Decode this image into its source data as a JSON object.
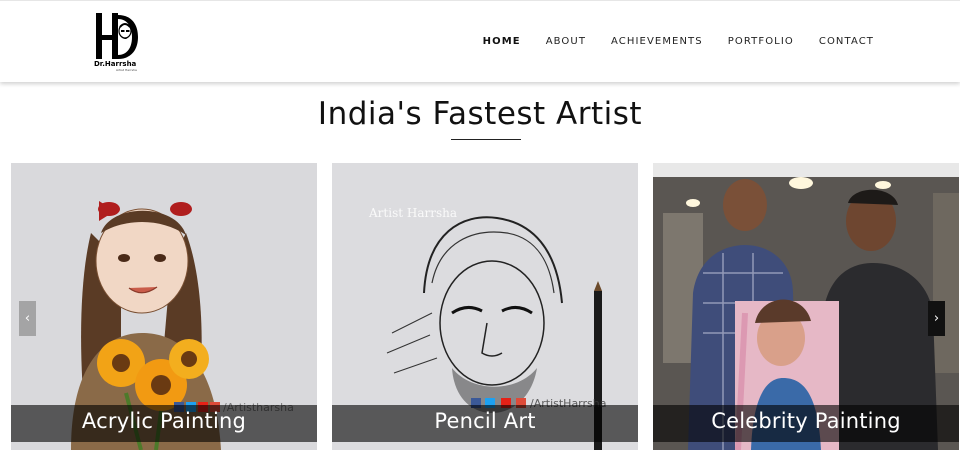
{
  "logo": {
    "caption": "Dr.Harrsha",
    "sub": "Artist Harrsha"
  },
  "nav": {
    "items": [
      {
        "label": "HOME",
        "active": true
      },
      {
        "label": "ABOUT",
        "active": false
      },
      {
        "label": "ACHIEVEMENTS",
        "active": false
      },
      {
        "label": "PORTFOLIO",
        "active": false
      },
      {
        "label": "CONTACT",
        "active": false
      }
    ]
  },
  "hero": {
    "title": "India's Fastest Artist"
  },
  "carousel": {
    "prev_icon": "‹",
    "next_icon": "›",
    "slides": [
      {
        "caption": "Acrylic Painting",
        "handle": "/Artistharsha"
      },
      {
        "caption": "Pencil Art",
        "watermark": "Artist Harrsha",
        "handle": "/ArtistHarrsha"
      },
      {
        "caption": "Celebrity Painting"
      }
    ]
  },
  "colors": {
    "facebook": "#3b5998",
    "twitter": "#1da1f2",
    "youtube": "#e62117",
    "google_plus": "#dd4b39"
  }
}
